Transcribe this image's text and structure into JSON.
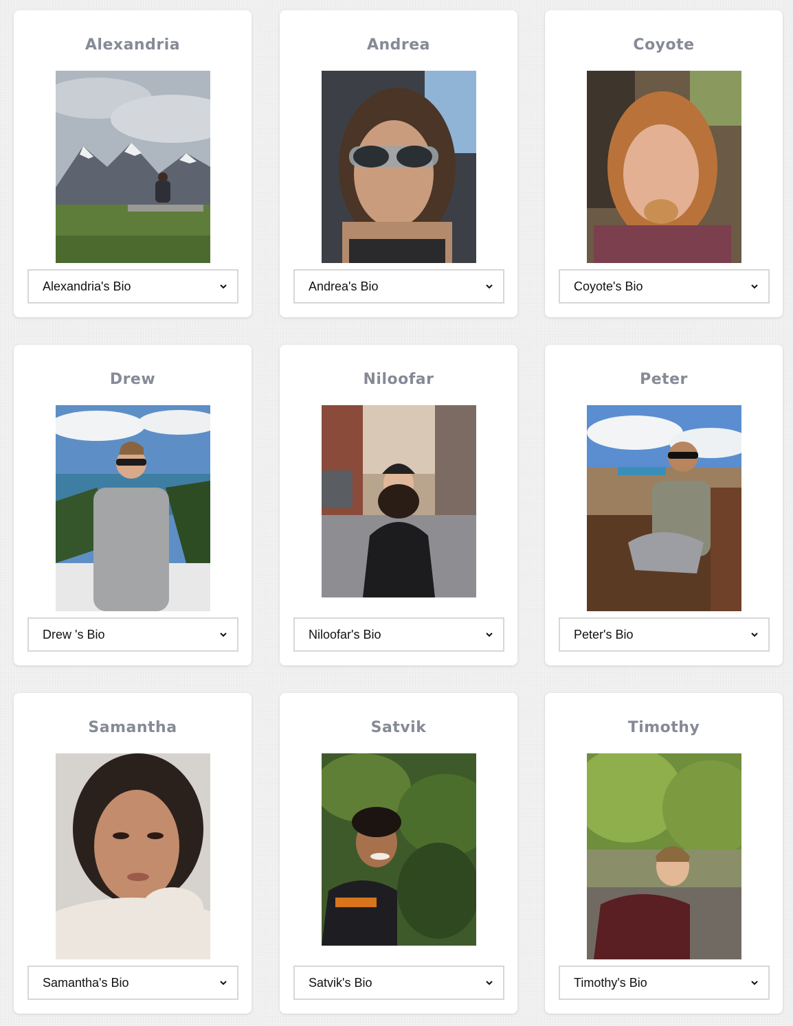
{
  "team": {
    "members": [
      {
        "name": "Alexandria",
        "bio_label": "Alexandria's Bio",
        "photo": "mountain-landscape-photo"
      },
      {
        "name": "Andrea",
        "bio_label": "Andrea's Bio",
        "photo": "car-selfie-photo"
      },
      {
        "name": "Coyote",
        "bio_label": "Coyote's Bio",
        "photo": "outdoor-selfie-photo"
      },
      {
        "name": "Drew",
        "bio_label": "Drew 's Bio",
        "photo": "ocean-overlook-photo"
      },
      {
        "name": "Niloofar",
        "bio_label": "Niloofar's Bio",
        "photo": "city-street-photo"
      },
      {
        "name": "Peter",
        "bio_label": "Peter's Bio",
        "photo": "boat-river-photo"
      },
      {
        "name": "Samantha",
        "bio_label": "Samantha's Bio",
        "photo": "portrait-selfie-photo"
      },
      {
        "name": "Satvik",
        "bio_label": "Satvik's Bio",
        "photo": "garden-photo"
      },
      {
        "name": "Timothy",
        "bio_label": "Timothy's Bio",
        "photo": "riverbank-forest-photo"
      }
    ]
  },
  "icons": {
    "dropdown": "chevron-down-icon"
  },
  "colors": {
    "name_text": "#868a96",
    "card_bg": "#ffffff",
    "dropdown_border": "#d7d7d7"
  }
}
